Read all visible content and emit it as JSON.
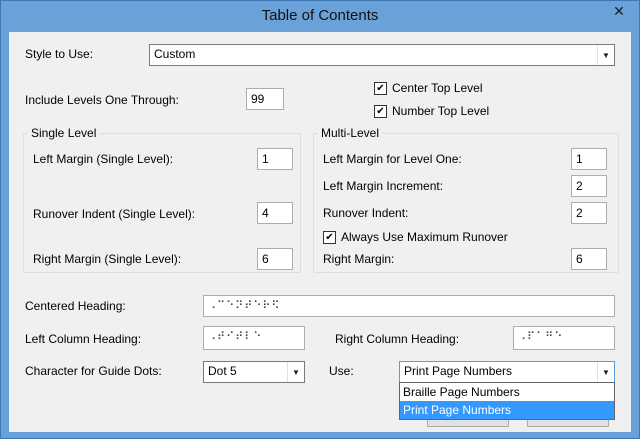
{
  "window": {
    "title": "Table of Contents",
    "close_glyph": "✕"
  },
  "style": {
    "label": "Style to Use:",
    "value": "Custom"
  },
  "levels": {
    "label": "Include Levels One Through:",
    "value": "99"
  },
  "checks": {
    "center_top": "Center Top Level",
    "number_top": "Number Top Level",
    "always_max": "Always Use Maximum Runover",
    "check_glyph": "✔"
  },
  "single": {
    "title": "Single Level",
    "left_margin_label": "Left Margin (Single Level):",
    "left_margin": "1",
    "runover_label": "Runover Indent (Single Level):",
    "runover": "4",
    "right_margin_label": "Right Margin (Single Level):",
    "right_margin": "6"
  },
  "multi": {
    "title": "Multi-Level",
    "left_margin_label": "Left Margin for Level One:",
    "left_margin": "1",
    "increment_label": "Left Margin Increment:",
    "increment": "2",
    "runover_label": "Runover Indent:",
    "runover": "2",
    "right_margin_label": "Right Margin:",
    "right_margin": "6"
  },
  "headings": {
    "centered_label": "Centered Heading:",
    "centered": "⠠⠉⠑⠝⠞⠑⠗⠫",
    "left_label": "Left Column Heading:",
    "left": "⠠⠞⠊⠞⠇⠑",
    "right_label": "Right Column Heading:",
    "right": "⠠⠏⠁⠛⠑"
  },
  "guide": {
    "label": "Character for Guide Dots:",
    "value": "Dot 5"
  },
  "use": {
    "label": "Use:",
    "value": "Print Page Numbers",
    "options": [
      "Braille Page Numbers",
      "Print Page Numbers"
    ]
  },
  "colors": {
    "titlebar": "#6aa1d8",
    "selection": "#3399ff",
    "client": "#f0f0f0"
  },
  "icons": {
    "dropdown": "chevron-down-icon",
    "close": "close-icon",
    "check": "checkmark-icon"
  }
}
